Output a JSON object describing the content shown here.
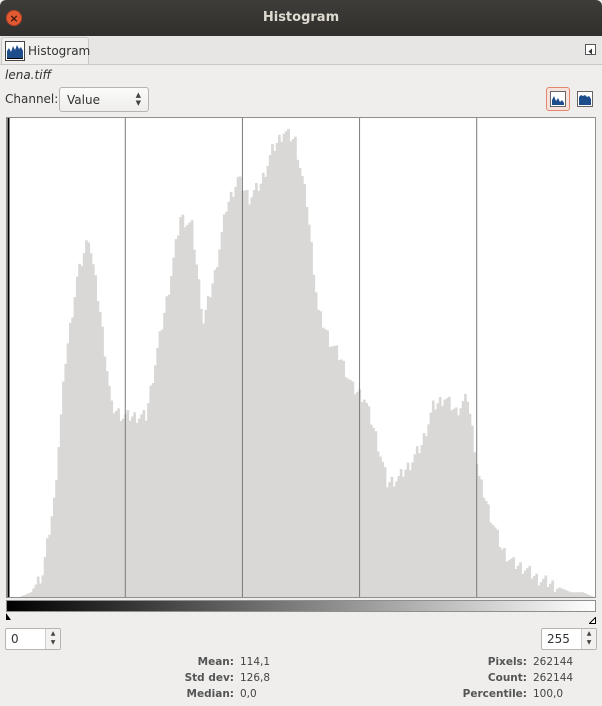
{
  "window": {
    "title": "Histogram",
    "close_glyph": "×"
  },
  "tab": {
    "label": "Histogram",
    "icon": "histogram-icon"
  },
  "file": {
    "name": "lena.tiff"
  },
  "channel": {
    "label": "Channel:",
    "value": "Value"
  },
  "range": {
    "low": "0",
    "high": "255"
  },
  "stats_left": [
    {
      "label": "Mean:",
      "value": "114,1"
    },
    {
      "label": "Std dev:",
      "value": "126,8"
    },
    {
      "label": "Median:",
      "value": "0,0"
    }
  ],
  "stats_right": [
    {
      "label": "Pixels:",
      "value": "262144"
    },
    {
      "label": "Count:",
      "value": "262144"
    },
    {
      "label": "Percentile:",
      "value": "100,0"
    }
  ],
  "colors": {
    "bars": "#d9d8d6",
    "accent": "#e2866b",
    "titlebar": "#3b3a36",
    "close": "#e25a31"
  },
  "chart_data": {
    "type": "bar",
    "x_range": [
      0,
      255
    ],
    "y_range": [
      0,
      100
    ],
    "y_units": "percent of peak",
    "grid_lines_x": [
      51,
      102,
      153,
      204
    ],
    "x": [
      0,
      5,
      10,
      15,
      20,
      25,
      30,
      35,
      40,
      45,
      50,
      55,
      60,
      65,
      70,
      75,
      80,
      85,
      90,
      95,
      100,
      105,
      110,
      115,
      120,
      125,
      130,
      135,
      140,
      145,
      150,
      155,
      160,
      165,
      170,
      175,
      180,
      185,
      190,
      195,
      200,
      205,
      210,
      215,
      220,
      225,
      230,
      235,
      240,
      245,
      250,
      255
    ],
    "values": [
      0,
      0,
      1,
      5,
      20,
      50,
      67,
      76,
      60,
      40,
      38,
      38,
      38,
      52,
      65,
      80,
      78,
      58,
      68,
      82,
      88,
      84,
      87,
      94,
      98,
      96,
      83,
      60,
      54,
      50,
      44,
      42,
      34,
      24,
      25,
      28,
      32,
      40,
      42,
      39,
      42,
      25,
      17,
      10,
      7,
      6,
      4,
      3,
      2,
      1,
      1,
      0
    ]
  }
}
